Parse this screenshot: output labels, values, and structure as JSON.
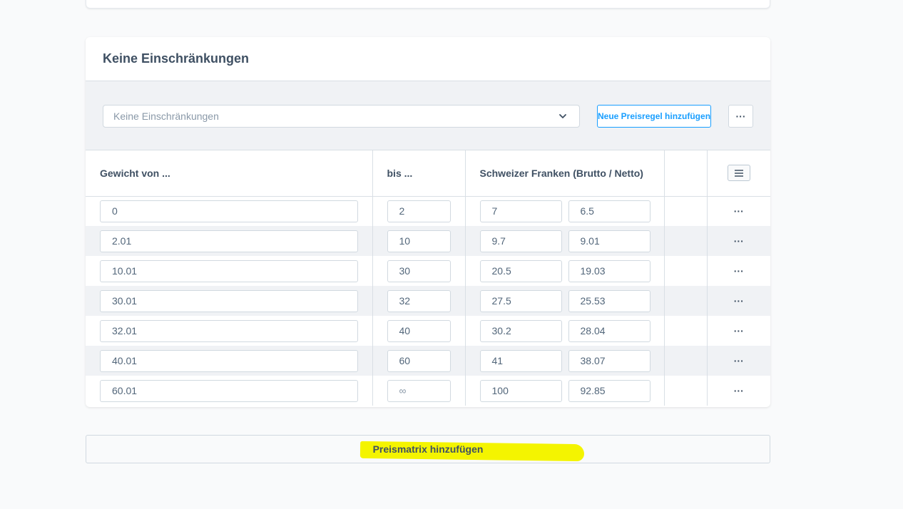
{
  "card": {
    "title": "Keine Einschränkungen",
    "rule_select_value": "Keine Einschränkungen",
    "add_rule_button": "Neue Preisregel hinzufügen",
    "more_button": "···"
  },
  "table": {
    "headers": {
      "from": "Gewicht von ...",
      "to": "bis ...",
      "price": "Schweizer Franken (Brutto / Netto)"
    },
    "rows": [
      {
        "from": "0",
        "to": "2",
        "brutto": "7",
        "netto": "6.5"
      },
      {
        "from": "2.01",
        "to": "10",
        "brutto": "9.7",
        "netto": "9.01"
      },
      {
        "from": "10.01",
        "to": "30",
        "brutto": "20.5",
        "netto": "19.03"
      },
      {
        "from": "30.01",
        "to": "32",
        "brutto": "27.5",
        "netto": "25.53"
      },
      {
        "from": "32.01",
        "to": "40",
        "brutto": "30.2",
        "netto": "28.04"
      },
      {
        "from": "40.01",
        "to": "60",
        "brutto": "41",
        "netto": "38.07"
      },
      {
        "from": "60.01",
        "to": "∞",
        "brutto": "100",
        "netto": "92.85"
      }
    ],
    "row_action": "···"
  },
  "footer": {
    "add_matrix_button": "Preismatrix hinzufügen",
    "highlight_color": "#f4f400"
  },
  "colors": {
    "accent": "#189eff",
    "text": "#52667a",
    "heading": "#3f5063"
  }
}
